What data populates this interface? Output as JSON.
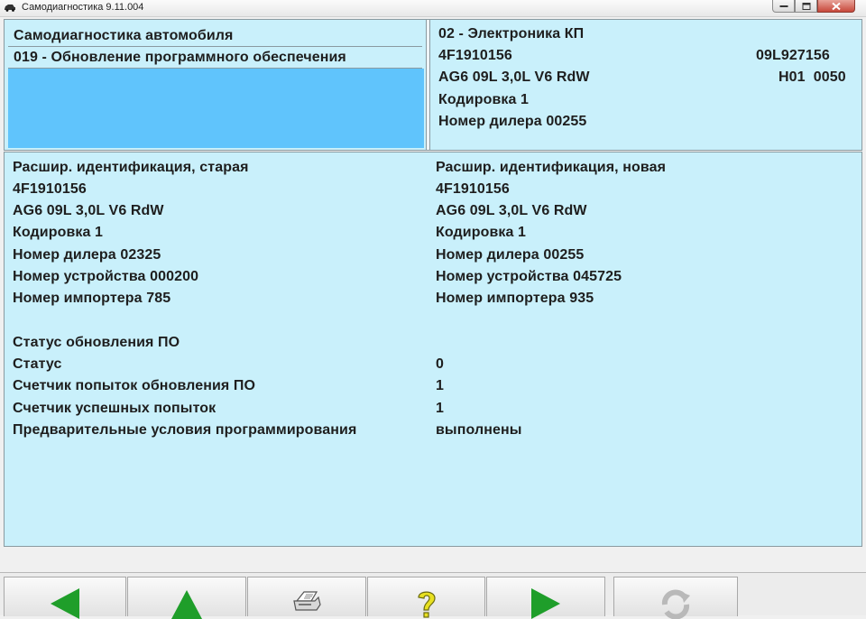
{
  "window": {
    "title": "Самодиагностика 9.11.004",
    "controls": [
      "minimize-icon",
      "maximize-icon",
      "close-icon"
    ]
  },
  "header_left": {
    "title": "Самодиагностика автомобиля",
    "selected_function": "019 - Обновление программного обеспечения"
  },
  "header_right": {
    "ecu_name": "02 - Электроника КП",
    "part_number": "4F1910156",
    "part_number_alt": "09L927156",
    "component": "AG6 09L 3,0L V6 RdW",
    "version": "H01  0050",
    "coding": "Кодировка 1",
    "dealer": "Номер дилера 00255"
  },
  "ident_old": {
    "heading": "Расшир. идентификация, старая",
    "part_number": "4F1910156",
    "component": "AG6 09L 3,0L V6 RdW",
    "coding": "Кодировка 1",
    "dealer": "Номер дилера 02325",
    "device": "Номер устройства 000200",
    "importer": "Номер импортера 785"
  },
  "ident_new": {
    "heading": "Расшир. идентификация, новая",
    "part_number": "4F1910156",
    "component": "AG6 09L 3,0L V6 RdW",
    "coding": "Кодировка 1",
    "dealer": "Номер дилера 00255",
    "device": "Номер устройства 045725",
    "importer": "Номер импортера 935"
  },
  "update_status": {
    "heading": "Статус обновления ПО",
    "rows": [
      {
        "label": "Статус",
        "value": "0"
      },
      {
        "label": "Счетчик попыток обновления ПО",
        "value": "1"
      },
      {
        "label": "Счетчик успешных попыток",
        "value": "1"
      },
      {
        "label": "Предварительные условия программирования",
        "value": "выполнены"
      }
    ]
  },
  "toolbar": {
    "buttons": [
      "back-arrow-icon",
      "up-arrow-icon",
      "printer-icon",
      "help-icon",
      "forward-arrow-icon",
      "refresh-icon"
    ]
  },
  "colors": {
    "panel_bg": "#c9f0fb",
    "selection": "#60c4fc",
    "arrow_green": "#1f9e2a",
    "help_yellow": "#e8e020"
  }
}
